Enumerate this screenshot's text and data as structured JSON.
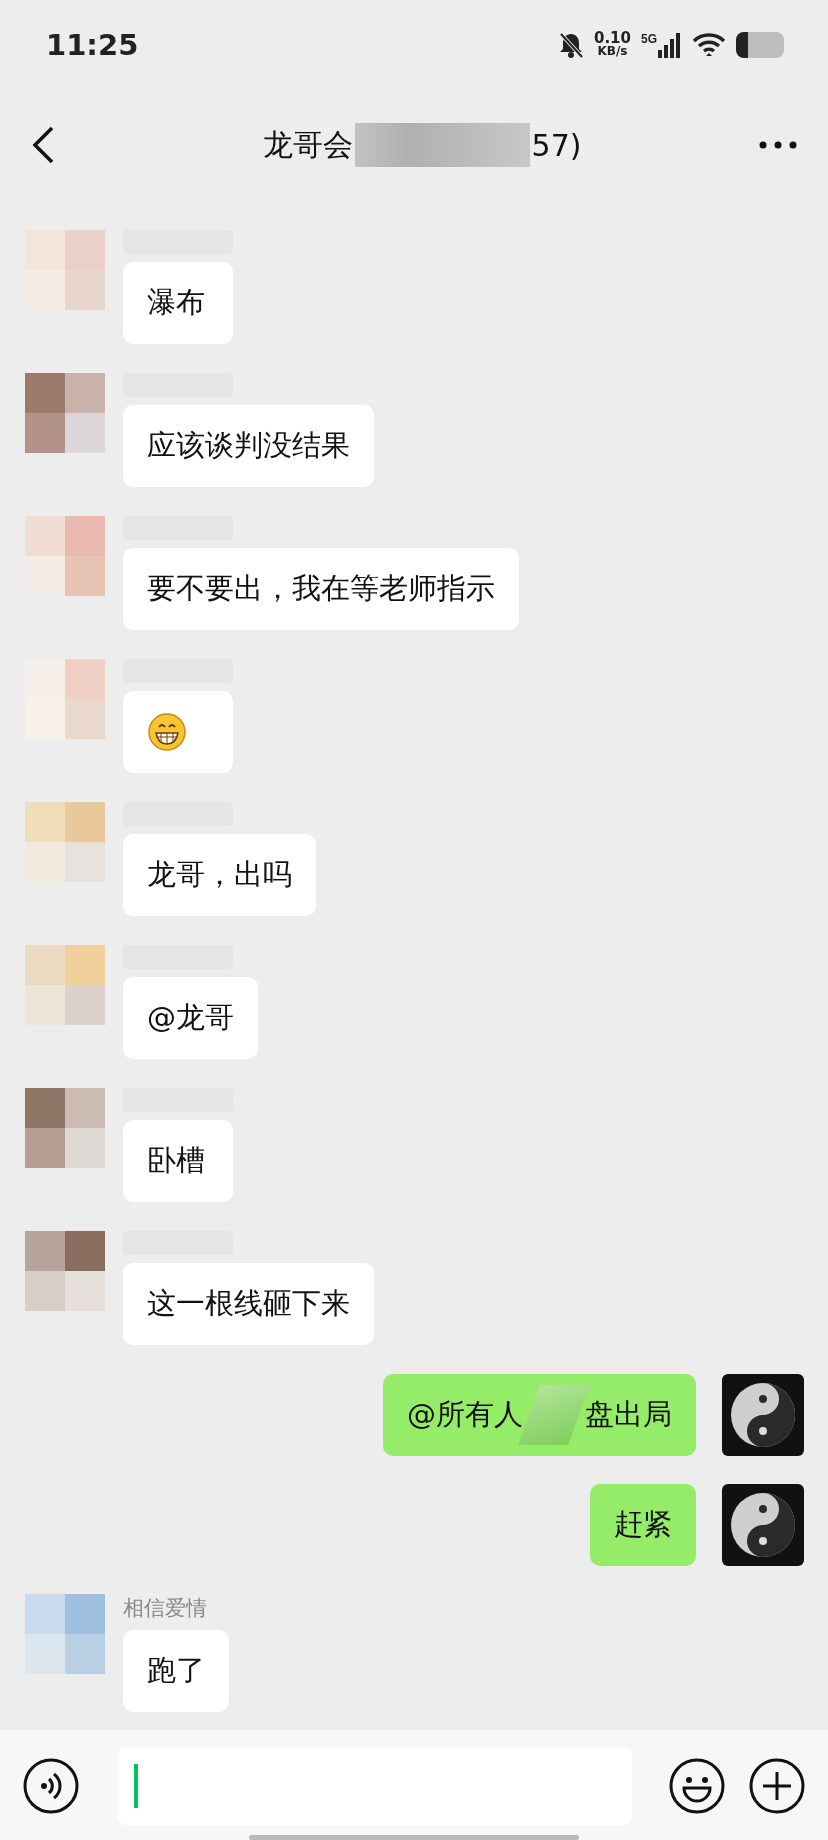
{
  "status_bar": {
    "time": "11:25",
    "net_speed": "0.10",
    "net_unit": "KB/s",
    "network": "5G"
  },
  "header": {
    "title_start": "龙哥会",
    "title_end": "57)"
  },
  "messages": [
    {
      "outgoing": false,
      "kind": "text",
      "text": "瀑布"
    },
    {
      "outgoing": false,
      "kind": "text",
      "text": "应该谈判没结果"
    },
    {
      "outgoing": false,
      "kind": "text",
      "text": "要不要出，我在等老师指示"
    },
    {
      "outgoing": false,
      "kind": "emoji"
    },
    {
      "outgoing": false,
      "kind": "text",
      "text": "龙哥，出吗"
    },
    {
      "outgoing": false,
      "kind": "text",
      "text": "@龙哥"
    },
    {
      "outgoing": false,
      "kind": "text",
      "text": "卧槽"
    },
    {
      "outgoing": false,
      "kind": "text",
      "text": "这一根线砸下来"
    },
    {
      "outgoing": true,
      "kind": "masked",
      "text": "@所有人",
      "text_end": "盘出局"
    },
    {
      "outgoing": true,
      "kind": "text",
      "text": "赶紧"
    },
    {
      "outgoing": false,
      "kind": "text",
      "text": "跑了",
      "sender": "相信爱情"
    }
  ]
}
